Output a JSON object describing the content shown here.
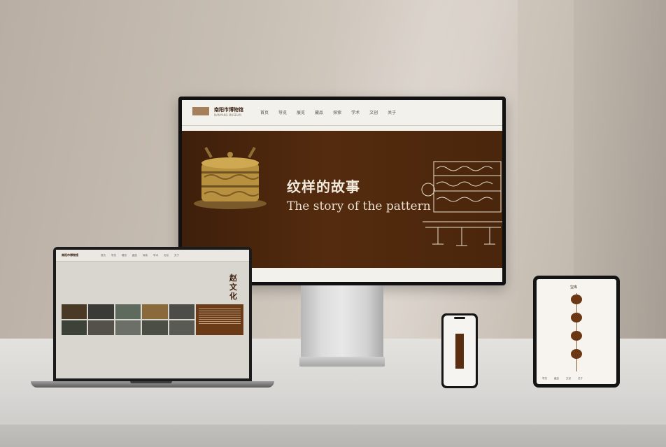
{
  "monitor": {
    "logo_text": "南阳市博物馆",
    "logo_sub": "NANYANG MUSEUM",
    "menu": [
      "首页",
      "导览",
      "展览",
      "藏品",
      "探索",
      "学术",
      "文创",
      "关于"
    ],
    "hero_title_cn": "纹样的故事",
    "hero_title_en": "The story of the pattern"
  },
  "laptop": {
    "logo_text": "南阳市博物馆",
    "menu": [
      "首页",
      "导览",
      "展览",
      "藏品",
      "探索",
      "学术",
      "文创",
      "关于"
    ],
    "heading": "赵文化"
  },
  "tablet": {
    "title": "宝库",
    "bar": [
      "导览",
      "藏品",
      "文创",
      "关于"
    ]
  },
  "colors": {
    "hero_brown": "#542b0e",
    "wall": "#c8bfb4",
    "gold": "#c9a04a"
  }
}
